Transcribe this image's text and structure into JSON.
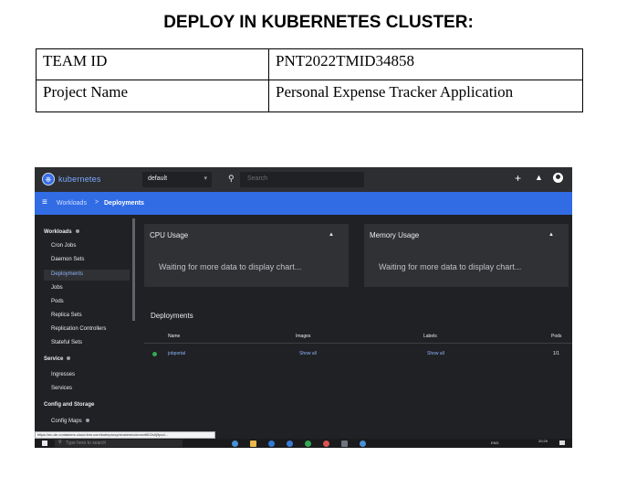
{
  "heading": "DEPLOY IN KUBERNETES CLUSTER:",
  "info_table": [
    {
      "key": "TEAM ID",
      "value": "PNT2022TMID34858"
    },
    {
      "key": "Project Name",
      "value": "Personal Expense Tracker Application"
    }
  ],
  "screenshot": {
    "brand": "kubernetes",
    "namespace": "default",
    "search_placeholder": "Search",
    "breadcrumb": {
      "parent": "Workloads",
      "separator": ">",
      "current": "Deployments"
    },
    "sidebar": {
      "workloads_header": "Workloads",
      "workload_items": [
        "Cron Jobs",
        "Daemon Sets",
        "Deployments",
        "Jobs",
        "Pods",
        "Replica Sets",
        "Replication Controllers",
        "Stateful Sets"
      ],
      "service_header": "Service",
      "service_items": [
        "Ingresses",
        "Services"
      ],
      "config_header": "Config and Storage",
      "config_items": [
        "Config Maps"
      ]
    },
    "cpu_card": {
      "title": "CPU Usage",
      "message": "Waiting for more data to display chart..."
    },
    "memory_card": {
      "title": "Memory Usage",
      "message": "Waiting for more data to display chart..."
    },
    "deployments": {
      "title": "Deployments",
      "columns": [
        "Name",
        "Images",
        "Labels",
        "Pods"
      ],
      "row": {
        "name": "jobportal",
        "images": "Show all",
        "labels": "Show all",
        "pods": "1/1"
      }
    },
    "url": "https://eu-de.containers.cloud.ibm.com/kubeproxy/clusters/cdcmcnf802s0j9pcd...",
    "taskbar": {
      "search_placeholder": "Type here to search",
      "tray": "ENG",
      "time": "20:29"
    },
    "colors": {
      "accent": "#326ce5",
      "background": "#202124",
      "card": "#303134",
      "status_ok": "#34a853",
      "link": "#8ab4f8"
    }
  }
}
